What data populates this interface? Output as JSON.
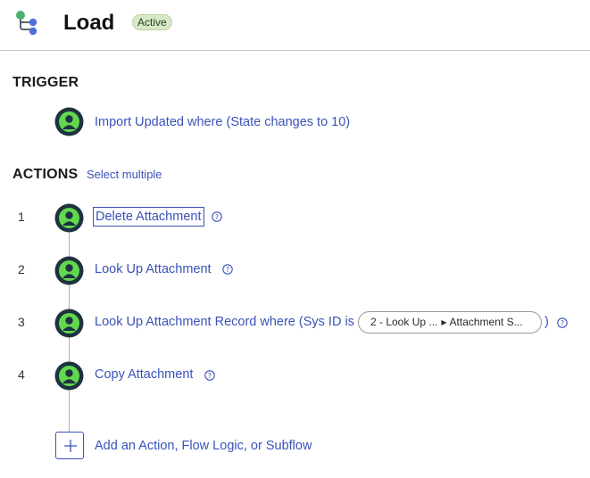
{
  "header": {
    "title": "Load",
    "status_badge": "Active"
  },
  "trigger": {
    "heading": "TRIGGER",
    "label": "Import Updated where (State changes to 10)"
  },
  "actions": {
    "heading": "ACTIONS",
    "select_multiple": "Select multiple",
    "items": [
      {
        "number": "1",
        "label": "Delete Attachment"
      },
      {
        "number": "2",
        "label": "Look Up Attachment"
      },
      {
        "number": "3",
        "label": "Look Up Attachment Record where (Sys ID is",
        "pill_source": "2 - Look Up ...",
        "pill_field": "Attachment S...",
        "suffix": ")"
      },
      {
        "number": "4",
        "label": "Copy Attachment"
      }
    ],
    "add_label": "Add an Action, Flow Logic, or Subflow"
  },
  "colors": {
    "link": "#3a52b8",
    "step_icon_ring": "#1e3340",
    "step_icon_green": "#62d84e",
    "badge_bg": "#d8e9c8"
  }
}
